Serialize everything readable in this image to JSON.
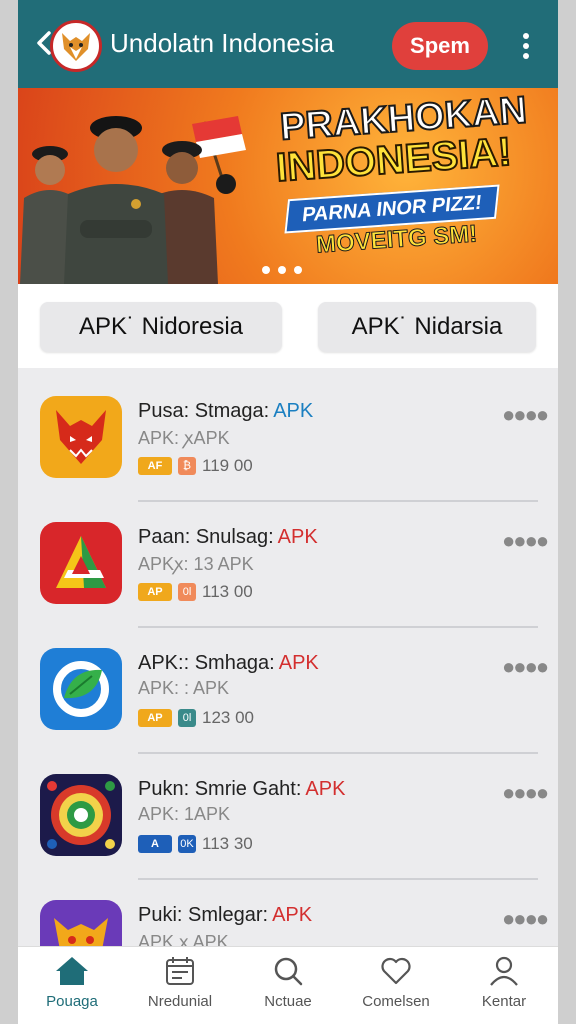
{
  "header": {
    "back_icon": "chevron-left-icon",
    "logo": "fox-logo",
    "title": "Undolatn Indonesia",
    "action_label": "Spem",
    "menu_icon": "kebab-menu-icon",
    "color": "#216d78"
  },
  "banner": {
    "headline1": "PRAKHOKAN",
    "headline2": "INDONESIA!",
    "ribbon": "PARNA INOR PIZZ!",
    "subline": "MOVEITG SM!",
    "page_dots": 3
  },
  "chips": [
    {
      "label": "APK˙ Nidoresia"
    },
    {
      "label": "APK˙ Nidarsia"
    }
  ],
  "apps": [
    {
      "name": "Pusa: Stmaga:",
      "apk_tag": "APK",
      "apk_color": "#1a7fc1",
      "subtitle": "APK: ꭗAPK",
      "badge1": "AF",
      "badge2": "₿",
      "badge2_color": "#f08a5a",
      "size": "119 00",
      "icon": "red-demon-app-icon"
    },
    {
      "name": "Paan: Snulsag:",
      "apk_tag": "APK",
      "apk_color": "#d32f2f",
      "subtitle": "APKꭗ: 13 APK",
      "badge1": "AP",
      "badge2": "0l",
      "badge2_color": "#f08a5a",
      "size": "113 00",
      "icon": "triangle-a-app-icon"
    },
    {
      "name": "APK:: Smhaga:",
      "apk_tag": "APK",
      "apk_color": "#d32f2f",
      "subtitle": "APK: : APK",
      "badge1": "AP",
      "badge2": "0l",
      "badge2_color": "#3a8a8a",
      "size": "123 00",
      "icon": "green-leaf-app-icon"
    },
    {
      "name": "Pukn: Smrie Gaht:",
      "apk_tag": "APK",
      "apk_color": "#d32f2f",
      "subtitle": "APK: 1APK",
      "badge1": "A",
      "badge2": "0K",
      "badge2_color": "#1e5fb8",
      "size": "113 30",
      "icon": "circle-emblem-app-icon"
    },
    {
      "name": "Puki: Smlegar:",
      "apk_tag": "APK",
      "apk_color": "#d32f2f",
      "subtitle": "APK ꭗ APK",
      "badge1": "",
      "badge2": "",
      "badge2_color": "#f08a5a",
      "size": "",
      "icon": "purple-beast-app-icon"
    }
  ],
  "bottom_nav": [
    {
      "label": "Pouaga",
      "icon": "home-icon",
      "active": true
    },
    {
      "label": "Nredunial",
      "icon": "calendar-icon",
      "active": false
    },
    {
      "label": "Nctuae",
      "icon": "search-icon",
      "active": false
    },
    {
      "label": "Comelsen",
      "icon": "heart-icon",
      "active": false
    },
    {
      "label": "Kentar",
      "icon": "user-icon",
      "active": false
    }
  ]
}
